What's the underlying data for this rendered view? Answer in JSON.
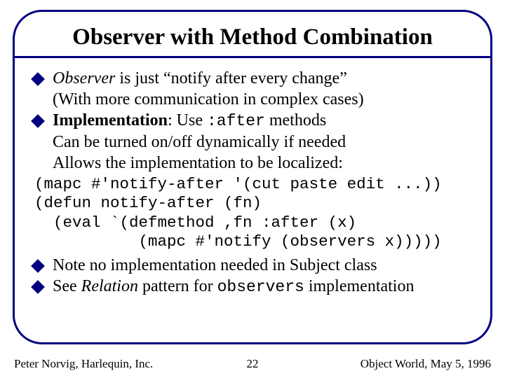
{
  "title": "Observer with Method Combination",
  "bullets": {
    "b1_emph": "Observer",
    "b1_rest": " is just “notify after every change”",
    "b1_cont": "(With more communication in complex cases)",
    "b2_label": "Implementation",
    "b2_mid": ": Use ",
    "b2_code": ":after",
    "b2_end": " methods",
    "b2_cont1": "Can be turned on/off dynamically if needed",
    "b2_cont2": "Allows the implementation to be localized:",
    "b3": "Note no implementation needed in Subject class",
    "b4_pre": "See ",
    "b4_emph": "Relation",
    "b4_mid": " pattern for ",
    "b4_code": "observers",
    "b4_end": " implementation"
  },
  "code": "(mapc #'notify-after '(cut paste edit ...))\n(defun notify-after (fn)\n  (eval `(defmethod ,fn :after (x)\n           (mapc #'notify (observers x)))))",
  "footer": {
    "left": "Peter Norvig, Harlequin, Inc.",
    "center": "22",
    "right": "Object World, May 5, 1996"
  }
}
